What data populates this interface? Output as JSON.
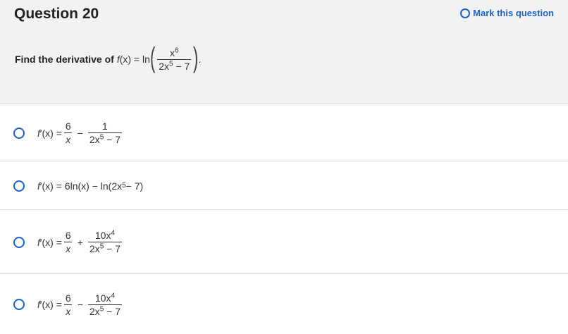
{
  "question": {
    "title": "Question 20",
    "mark_label": "Mark this question",
    "prompt": {
      "text": "Find the derivative of",
      "f": "f",
      "arg": "(x) = ln",
      "num_base": "x",
      "num_exp": "6",
      "den_base": "2x",
      "den_exp": "5",
      "den_tail": " − 7",
      "end": "."
    }
  },
  "options": [
    {
      "lhs_f": "f",
      "lhs_rest": "′(x) =",
      "f1_num": "6",
      "f1_den": "x",
      "op": "−",
      "f2_num": "1",
      "f2_num_exp": "",
      "f2_den_base": "2x",
      "f2_den_exp": "5",
      "f2_den_tail": " − 7"
    },
    {
      "lhs_f": "f",
      "lhs_rest": "′(x) = 6ln(x) − ln(2x",
      "exp": "5",
      "tail": " − 7)"
    },
    {
      "lhs_f": "f",
      "lhs_rest": "′(x) =",
      "f1_num": "6",
      "f1_den": "x",
      "op": "+",
      "f2_num": "10x",
      "f2_num_exp": "4",
      "f2_den_base": "2x",
      "f2_den_exp": "5",
      "f2_den_tail": " − 7"
    },
    {
      "lhs_f": "f",
      "lhs_rest": "′(x) =",
      "f1_num": "6",
      "f1_den": "x",
      "op": "−",
      "f2_num": "10x",
      "f2_num_exp": "4",
      "f2_den_base": "2x",
      "f2_den_exp": "5",
      "f2_den_tail": " − 7"
    }
  ],
  "colors": {
    "accent": "#1a62c6",
    "header_bg": "#f2f2f2",
    "divider": "#dcdcdc"
  }
}
